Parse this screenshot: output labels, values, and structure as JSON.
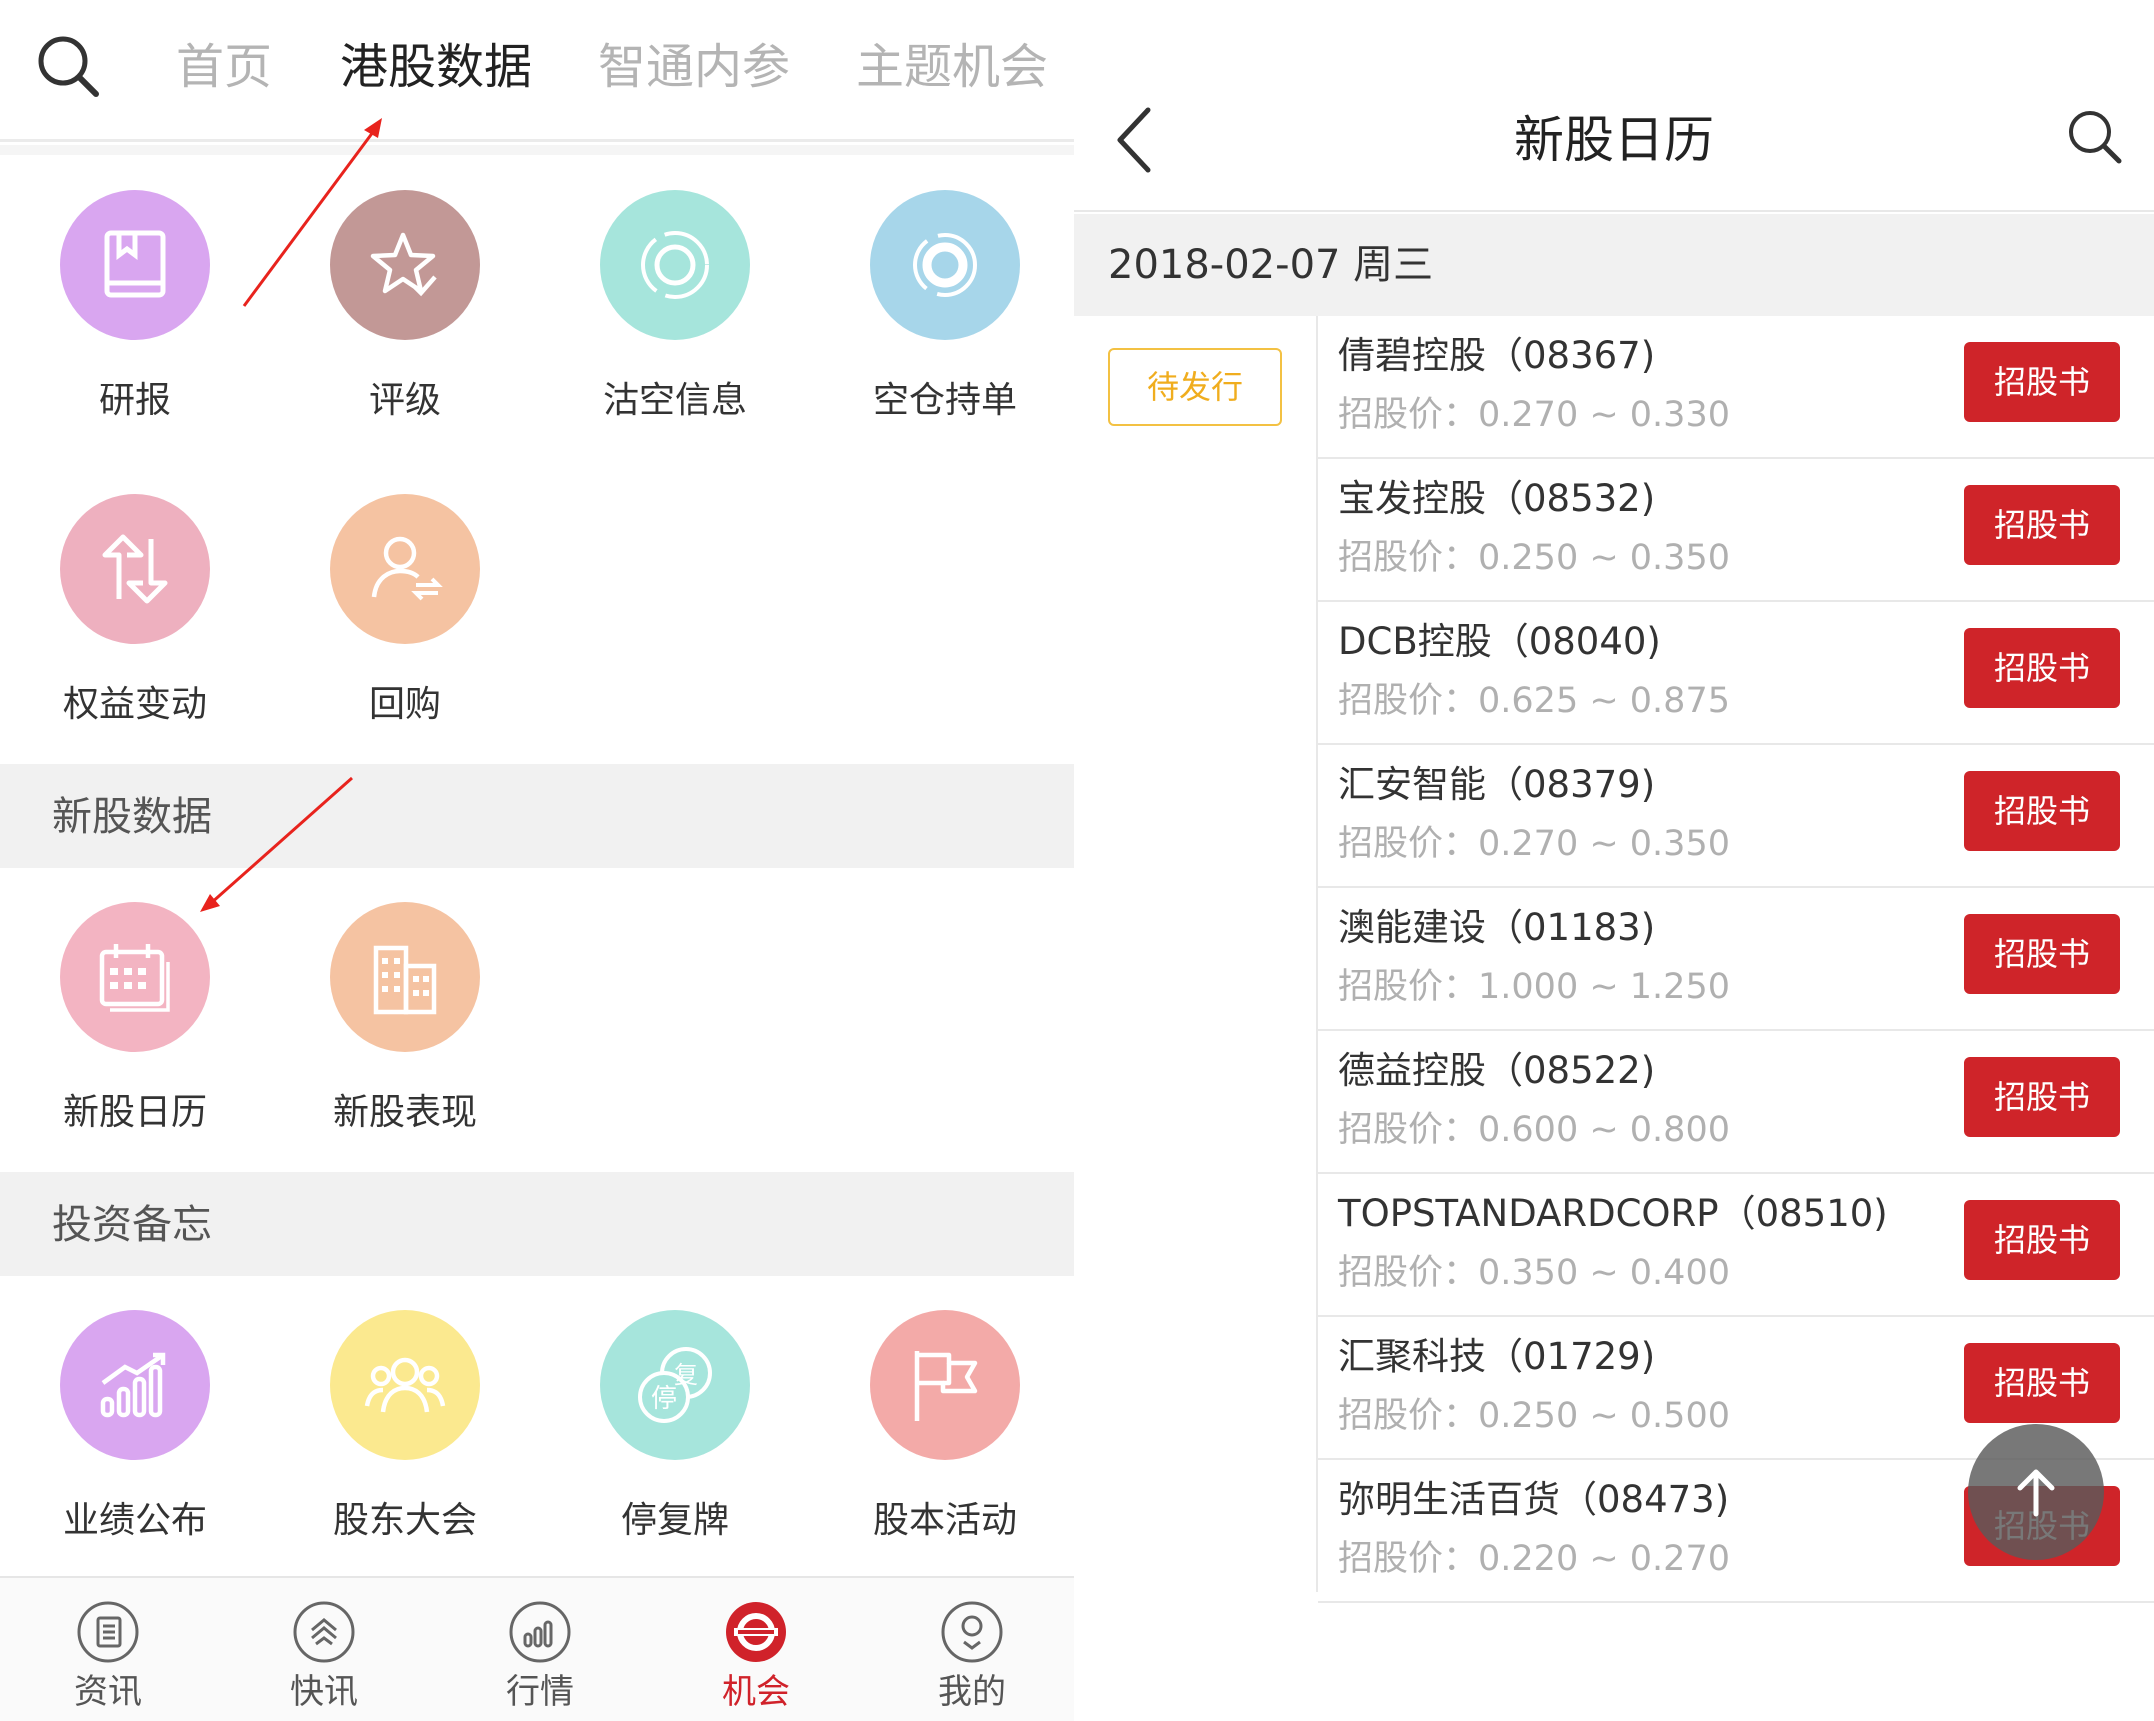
{
  "left": {
    "nav": {
      "tabs": [
        "首页",
        "港股数据",
        "智通内参",
        "主题机会"
      ],
      "active_index": 1
    },
    "grid1": [
      {
        "label": "研报",
        "color": "#d9a6f0",
        "icon": "book-icon"
      },
      {
        "label": "评级",
        "color": "#c29896",
        "icon": "star-check-icon"
      },
      {
        "label": "沽空信息",
        "color": "#a6e5dc",
        "icon": "ring-icon"
      },
      {
        "label": "空仓持单",
        "color": "#a7d6ea",
        "icon": "ring-thick-icon"
      },
      {
        "label": "权益变动",
        "color": "#eeb0bf",
        "icon": "up-down-arrows-icon"
      },
      {
        "label": "回购",
        "color": "#f5c3a2",
        "icon": "user-exchange-icon"
      }
    ],
    "section2": {
      "title": "新股数据"
    },
    "grid2": [
      {
        "label": "新股日历",
        "color": "#f3b4c2",
        "icon": "calendar-icon"
      },
      {
        "label": "新股表现",
        "color": "#f5c3a2",
        "icon": "buildings-icon"
      }
    ],
    "section3": {
      "title": "投资备忘"
    },
    "grid3": [
      {
        "label": "业绩公布",
        "color": "#d9a6f0",
        "icon": "growth-chart-icon"
      },
      {
        "label": "股东大会",
        "color": "#fbe98f",
        "icon": "people-icon"
      },
      {
        "label": "停复牌",
        "color": "#a6e5dc",
        "icon": "suspend-resume-icon"
      },
      {
        "label": "股本活动",
        "color": "#f3aaa8",
        "icon": "flag-icon"
      }
    ],
    "bottom_nav": [
      {
        "label": "资讯",
        "icon": "news-icon"
      },
      {
        "label": "快讯",
        "icon": "flash-icon"
      },
      {
        "label": "行情",
        "icon": "market-icon"
      },
      {
        "label": "机会",
        "icon": "opportunity-icon"
      },
      {
        "label": "我的",
        "icon": "profile-icon"
      }
    ],
    "bottom_active_index": 3,
    "accent_color": "#d0222a"
  },
  "right": {
    "title": "新股日历",
    "date": "2018-02-07 周三",
    "status_tag": "待发行",
    "price_prefix": "招股价：",
    "button_label": "招股书",
    "stocks": [
      {
        "name": "倩碧控股（08367)",
        "price": "0.270 ~ 0.330"
      },
      {
        "name": "宝发控股（08532)",
        "price": "0.250 ~ 0.350"
      },
      {
        "name": "DCB控股（08040)",
        "price": "0.625 ~ 0.875"
      },
      {
        "name": "汇安智能（08379)",
        "price": "0.270 ~ 0.350"
      },
      {
        "name": "澳能建设（01183)",
        "price": "1.000 ~ 1.250"
      },
      {
        "name": "德益控股（08522)",
        "price": "0.600 ~ 0.800"
      },
      {
        "name": "TOPSTANDARDCORP（08510)",
        "price": "0.350 ~ 0.400"
      },
      {
        "name": "汇聚科技（01729)",
        "price": "0.250 ~ 0.500"
      },
      {
        "name": "弥明生活百货（08473)",
        "price": "0.220 ~ 0.270"
      }
    ],
    "button_color": "#cf2429",
    "tag_color": "#f0ad1e"
  }
}
